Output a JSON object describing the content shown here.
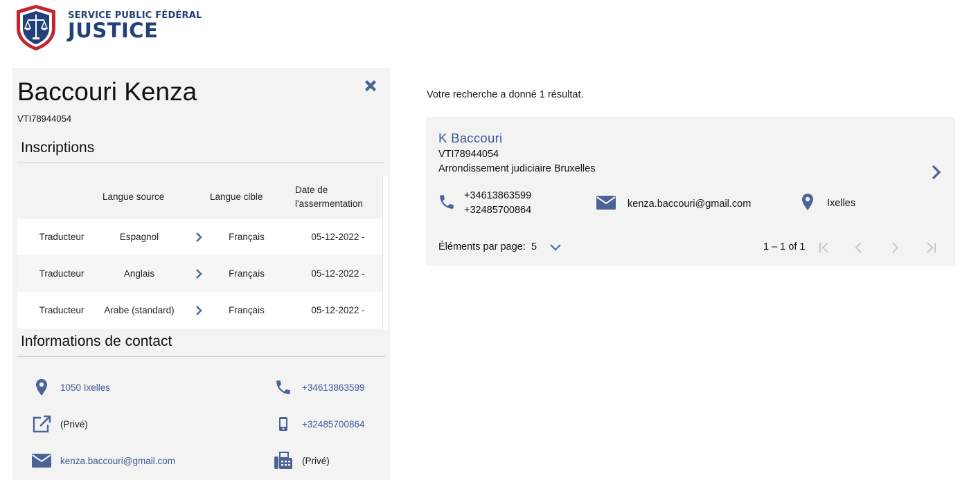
{
  "brand": {
    "line1": "SERVICE PUBLIC FÉDÉRAL",
    "line2": "JUSTICE",
    "primary_color": "#22407a",
    "accent_color": "#c0272d"
  },
  "detail": {
    "name": "Baccouri Kenza",
    "id": "VTI78944054",
    "close_icon": "close-x-icon",
    "inscriptions_title": "Inscriptions",
    "table": {
      "headers": [
        "Langue source",
        "Langue cible",
        "Date de l'assermentation"
      ],
      "header_date_line1": "Date de",
      "header_date_line2": "l'assermentation",
      "rows": [
        {
          "role": "Traducteur",
          "source": "Espagnol",
          "target": "Français",
          "date": "05-12-2022 -"
        },
        {
          "role": "Traducteur",
          "source": "Anglais",
          "target": "Français",
          "date": "05-12-2022 -"
        },
        {
          "role": "Traducteur",
          "source": "Arabe (standard)",
          "target": "Français",
          "date": "05-12-2022 -"
        }
      ]
    },
    "contact_title": "Informations de contact",
    "contact": {
      "address": "1050 Ixelles",
      "phone": "+34613863599",
      "website": "(Privé)",
      "mobile": "+32485700864",
      "email": "kenza.baccouri@gmail.com",
      "fax": "(Privé)"
    }
  },
  "results": {
    "summary": "Votre recherche a donné 1 résultat.",
    "card": {
      "name": "K Baccouri",
      "id": "VTI78944054",
      "district": "Arrondissement judiciaire Bruxelles",
      "phone1": "+34613863599",
      "phone2": "+32485700864",
      "email": "kenza.baccouri@gmail.com",
      "location": "Ixelles"
    },
    "pager": {
      "label": "Éléments par page:",
      "page_size": "5",
      "range": "1 – 1 of 1"
    }
  },
  "colors": {
    "icon": "#4a6296",
    "link": "#3d5a9c",
    "panel_bg": "#f3f3f3"
  }
}
